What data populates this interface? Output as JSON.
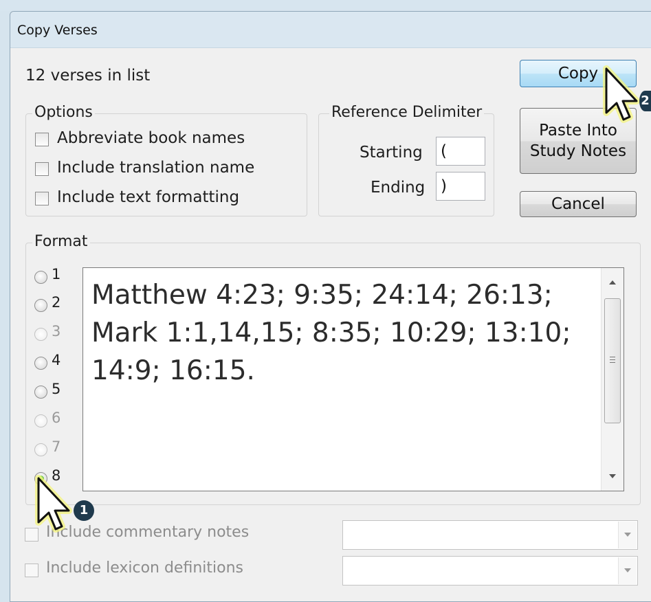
{
  "dialog": {
    "title": "Copy Verses"
  },
  "verse_count": "12 verses in list",
  "options": {
    "legend": "Options",
    "items": [
      {
        "label": "Abbreviate book names",
        "checked": false
      },
      {
        "label": "Include translation name",
        "checked": false
      },
      {
        "label": "Include text formatting",
        "checked": false
      }
    ]
  },
  "delimiter": {
    "legend": "Reference Delimiter",
    "starting_label": "Starting",
    "starting_value": "(",
    "ending_label": "Ending",
    "ending_value": ")"
  },
  "buttons": {
    "copy": "Copy",
    "paste_line1": "Paste Into",
    "paste_line2": "Study Notes",
    "cancel": "Cancel"
  },
  "format": {
    "legend": "Format",
    "options": [
      "1",
      "2",
      "3",
      "4",
      "5",
      "6",
      "7",
      "8"
    ],
    "selected": "8",
    "preview": "Matthew 4:23; 9:35; 24:14; 26:13; Mark 1:1,14,15; 8:35; 10:29; 13:10; 14:9; 16:15."
  },
  "extras": {
    "commentary_label": "Include commentary notes",
    "lexicon_label": "Include lexicon definitions"
  },
  "annotations": {
    "step1": "1",
    "step2": "2"
  },
  "colors": {
    "accent": "#a7d9f5",
    "badge": "#1f3a4d",
    "cursor_glow": "#f2f27a"
  }
}
